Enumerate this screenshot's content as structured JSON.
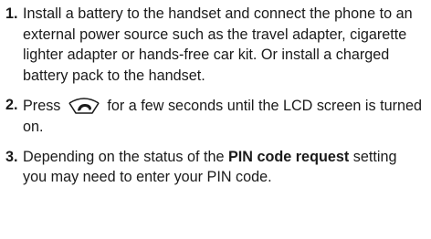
{
  "steps": [
    {
      "number": "1.",
      "text": "Install a battery to the handset and connect the phone to an external power source such as the travel adapter, cigarette lighter adapter or hands-free car kit. Or install a charged battery pack to the handset."
    },
    {
      "number": "2.",
      "text_before": "Press",
      "icon": "power-end-key-icon",
      "text_after": "for a few seconds until the LCD screen is turned on."
    },
    {
      "number": "3.",
      "text_before": "Depending on the status of the",
      "bold_text": "PIN code request",
      "text_after": "setting you may need to enter your PIN code."
    }
  ]
}
